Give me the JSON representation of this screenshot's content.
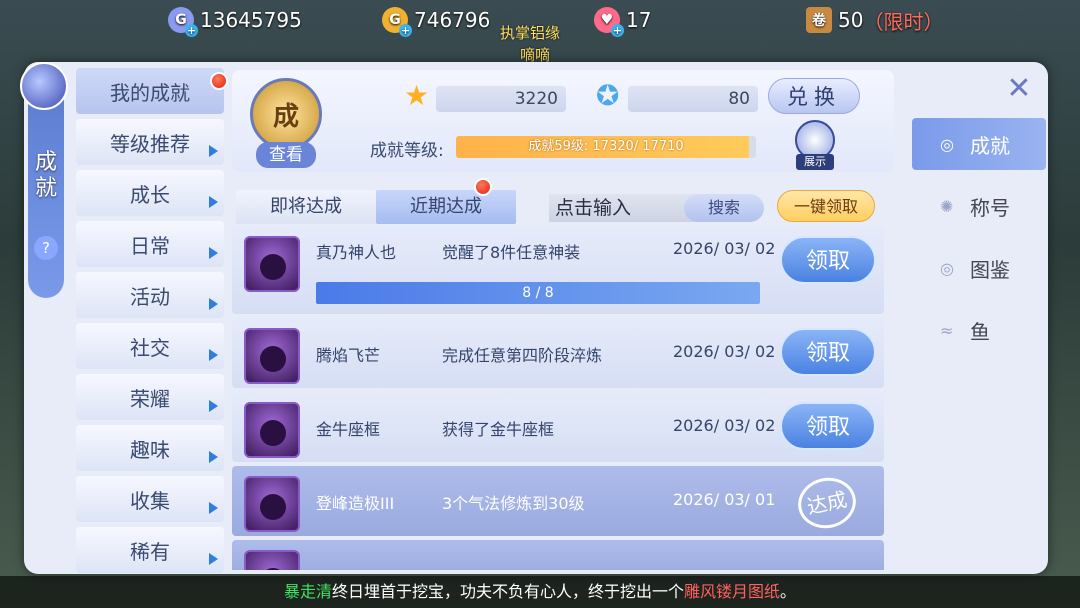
{
  "topbar": {
    "currency": [
      {
        "icon": "diamond-coin-icon",
        "symbol": "G",
        "value": "13645795",
        "color": "#8a9af0"
      },
      {
        "icon": "gold-coin-icon",
        "symbol": "G",
        "value": "746796",
        "color": "#f0b030"
      },
      {
        "icon": "heart-icon",
        "symbol": "♥",
        "value": "17",
        "color": "#ff6a8a"
      }
    ],
    "limited_count": "50",
    "limited_label": "（限时）"
  },
  "bg_texts": [
    "执掌铝缘",
    "嘀嘀"
  ],
  "sidebar": {
    "title": "成就",
    "help": "?"
  },
  "categories": [
    {
      "label": "我的成就",
      "active": true,
      "dot": true,
      "arrow": false
    },
    {
      "label": "等级推荐",
      "arrow": true
    },
    {
      "label": "成长",
      "arrow": true
    },
    {
      "label": "日常",
      "arrow": true
    },
    {
      "label": "活动",
      "arrow": true
    },
    {
      "label": "社交",
      "arrow": true
    },
    {
      "label": "荣耀",
      "arrow": true
    },
    {
      "label": "趣味",
      "arrow": true
    },
    {
      "label": "收集",
      "arrow": true
    },
    {
      "label": "稀有",
      "arrow": true
    }
  ],
  "header": {
    "badge_glyph": "成",
    "view_button": "查看",
    "star_points": "3220",
    "badge_points": "80",
    "exchange_button": "兑换",
    "level_label": "成就等级:",
    "level_text": "成就59级: 17320/ 17710",
    "level_progress": 0.978,
    "show_label": "展示"
  },
  "tabs": {
    "upcoming": "即将达成",
    "recent": "近期达成"
  },
  "search": {
    "placeholder": "点击输入",
    "button": "搜索"
  },
  "claim_all": "一键领取",
  "rows": [
    {
      "name": "真乃神人也",
      "desc": "觉醒了8件任意神装",
      "date": "2026/ 03/ 02",
      "action": "领取",
      "state": "claim",
      "progress": "8 / 8"
    },
    {
      "name": "腾焰飞芒",
      "desc": "完成任意第四阶段淬炼",
      "date": "2026/ 03/ 02",
      "action": "领取",
      "state": "claim"
    },
    {
      "name": "金牛座框",
      "desc": "获得了金牛座框",
      "date": "2026/ 03/ 02",
      "action": "领取",
      "state": "claim"
    },
    {
      "name": "登峰造极III",
      "desc": "3个气法修炼到30级",
      "date": "2026/ 03/ 01",
      "action": "达成",
      "state": "done"
    }
  ],
  "right_tabs": [
    {
      "label": "成就",
      "icon": "coins-icon",
      "active": true
    },
    {
      "label": "称号",
      "icon": "emblem-icon"
    },
    {
      "label": "图鉴",
      "icon": "coins-icon"
    },
    {
      "label": "鱼",
      "icon": "fish-icon"
    }
  ],
  "ticker": {
    "player": "暴走清",
    "text": "终日埋首于挖宝，功夫不负有心人，终于挖出一个",
    "item": "雕风镂月图纸",
    "end": "。"
  }
}
